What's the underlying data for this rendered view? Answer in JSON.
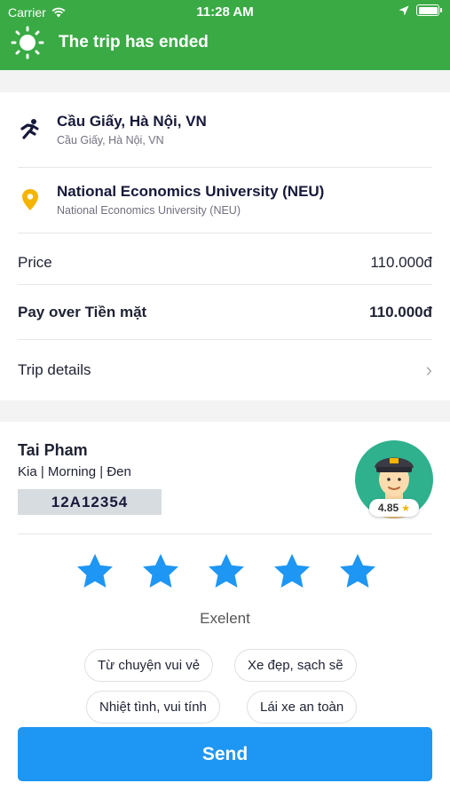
{
  "status_bar": {
    "carrier": "Carrier",
    "time": "11:28 AM"
  },
  "header": {
    "title": "The trip has ended",
    "accent": "#3aaa45"
  },
  "pickup": {
    "name": "Cầu Giấy, Hà Nội, VN",
    "detail": "Cầu Giấy, Hà Nội, VN"
  },
  "destination": {
    "name": "National Economics University (NEU)",
    "detail": "National Economics University (NEU)"
  },
  "price": {
    "label": "Price",
    "value": "110.000đ"
  },
  "payment": {
    "label": "Pay over Tiền mặt",
    "value": "110.000đ"
  },
  "trip_details": {
    "label": "Trip details"
  },
  "driver": {
    "name": "Tai Pham",
    "vehicle": "Kia | Morning | Đen",
    "plate": "12A12354",
    "rating": "4.85"
  },
  "feedback": {
    "stars_selected": 5,
    "star_color": "#1e96f3",
    "rating_label": "Exelent",
    "tags": [
      "Từ chuyện vui vẻ",
      "Xe đẹp, sạch sẽ",
      "Nhiệt tình, vui tính",
      "Lái xe an toàn"
    ]
  },
  "send_button": {
    "label": "Send",
    "color": "#1e96f3"
  }
}
